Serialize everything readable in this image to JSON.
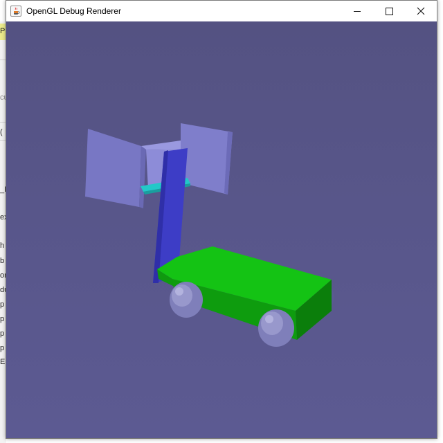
{
  "window": {
    "title": "OpenGL Debug Renderer",
    "icon": "java-cup-icon",
    "controls": [
      "minimize",
      "maximize",
      "close"
    ]
  },
  "background_app": {
    "visible_fragments": [
      "Pl",
      "cu",
      "(",
      "_N",
      "ex",
      "h",
      "b",
      "or",
      "du",
      "p",
      "p",
      "p",
      "p",
      "E"
    ]
  },
  "scene": {
    "background_color": "#555385",
    "objects": [
      "flag-panel",
      "pole",
      "cart-body",
      "front-wheel",
      "rear-wheel",
      "cyan-bar"
    ]
  },
  "colors": {
    "pole": "#3d3dc6",
    "flag_panel": "#8a8ad8",
    "cart_body": "#12b012",
    "wheel": "#8e8ec6",
    "cyan_bar": "#23c8c8"
  }
}
